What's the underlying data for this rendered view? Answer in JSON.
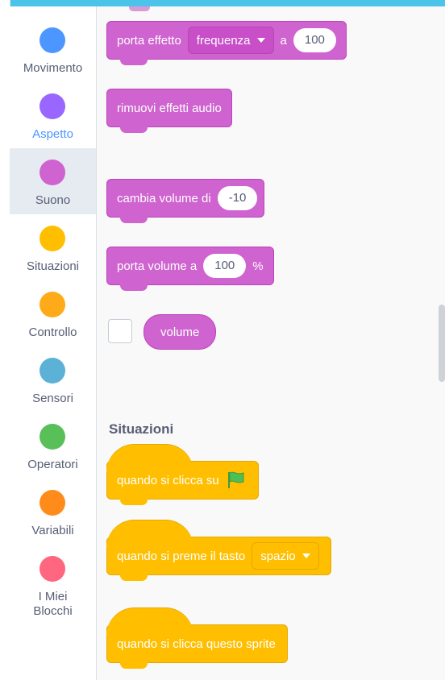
{
  "colors": {
    "motion": "#4c97ff",
    "looks": "#9966ff",
    "sound": "#cf63cf",
    "events": "#ffbf00",
    "control": "#ffab19",
    "sensing": "#5cb1d6",
    "operators": "#59c059",
    "variables": "#ff8c1a",
    "myblocks": "#ff6680"
  },
  "categories": [
    {
      "label": "Movimento",
      "color": "#4c97ff"
    },
    {
      "label": "Aspetto",
      "color": "#9966ff"
    },
    {
      "label": "Suono",
      "color": "#cf63cf"
    },
    {
      "label": "Situazioni",
      "color": "#ffbf00"
    },
    {
      "label": "Controllo",
      "color": "#ffab19"
    },
    {
      "label": "Sensori",
      "color": "#5cb1d6"
    },
    {
      "label": "Operatori",
      "color": "#59c059"
    },
    {
      "label": "Variabili",
      "color": "#ff8c1a"
    },
    {
      "label": "I Miei Blocchi",
      "color": "#ff6680"
    }
  ],
  "selected_category": "Suono",
  "blocks": {
    "set_effect": {
      "text_pre": "porta effetto",
      "dropdown": "frequenza",
      "text_mid": "a",
      "value": "100"
    },
    "clear_effects": {
      "text": "rimuovi effetti audio"
    },
    "change_volume": {
      "text": "cambia volume di",
      "value": "-10"
    },
    "set_volume": {
      "text": "porta volume a",
      "value": "100",
      "suffix": "%"
    },
    "volume_reporter": {
      "text": "volume"
    }
  },
  "events_section": {
    "title": "Situazioni",
    "when_flag": {
      "text": "quando si clicca su",
      "icon": "green-flag-icon"
    },
    "when_key": {
      "text": "quando si preme il tasto",
      "dropdown": "spazio"
    },
    "when_sprite": {
      "text": "quando si clicca questo sprite"
    }
  }
}
